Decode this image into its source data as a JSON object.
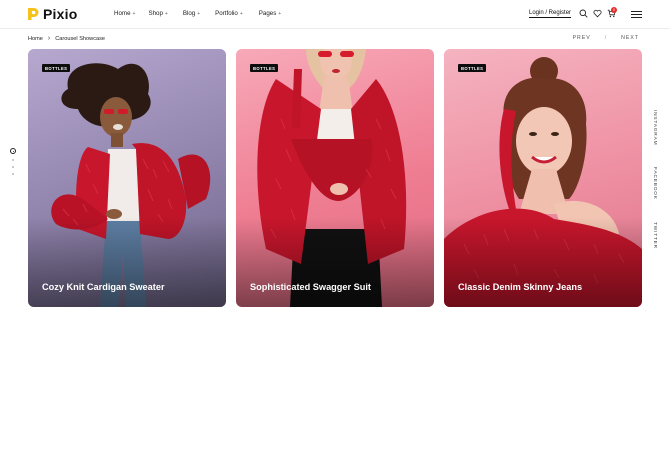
{
  "header": {
    "logo_text": "Pixio",
    "nav": [
      {
        "label": "Home"
      },
      {
        "label": "Shop"
      },
      {
        "label": "Blog"
      },
      {
        "label": "Portfolio"
      },
      {
        "label": "Pages"
      }
    ],
    "login_label": "Login / Register",
    "cart_count": "0",
    "icons": [
      "search-icon",
      "heart-icon",
      "cart-icon",
      "menu-icon"
    ]
  },
  "breadcrumb": {
    "home": "Home",
    "current": "Carousel Showcase"
  },
  "pager": {
    "prev": "PREV",
    "slash": "/",
    "next": "NEXT"
  },
  "social": [
    "INSTAGRAM",
    "FACEBOOK",
    "TWITTER"
  ],
  "cards": [
    {
      "tag": "BOTTLES",
      "title": "Cozy Knit Cardigan Sweater"
    },
    {
      "tag": "BOTTLES",
      "title": "Sophisticated Swagger Suit"
    },
    {
      "tag": "BOTTLES",
      "title": "Classic Denim Skinny Jeans"
    }
  ],
  "colors": {
    "accent_logo": "#f5c21b",
    "badge": "#e52b2b",
    "sweater_red": "#c8162c"
  }
}
